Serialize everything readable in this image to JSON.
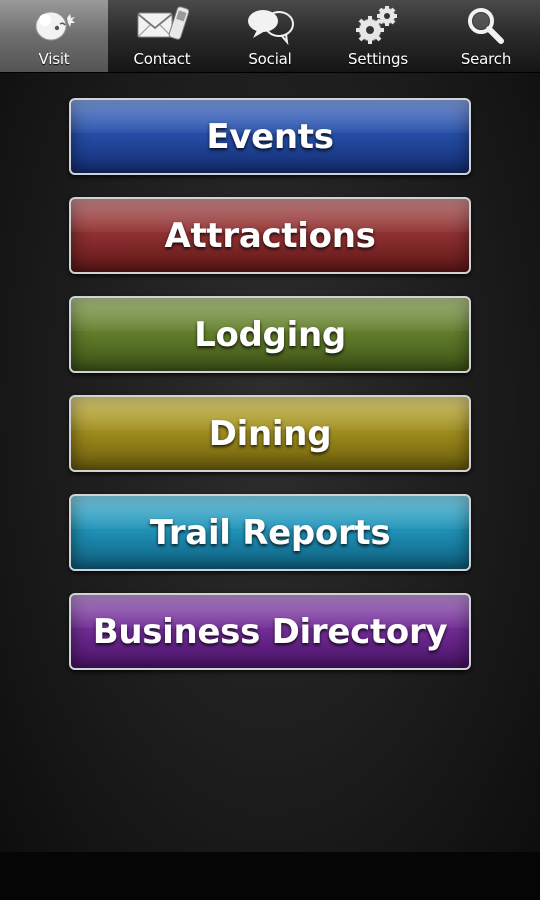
{
  "tabs": [
    {
      "label": "Visit",
      "icon": "face-icon",
      "selected": true
    },
    {
      "label": "Contact",
      "icon": "mail-phone-icon",
      "selected": false
    },
    {
      "label": "Social",
      "icon": "speech-bubbles-icon",
      "selected": false
    },
    {
      "label": "Settings",
      "icon": "gears-icon",
      "selected": false
    },
    {
      "label": "Search",
      "icon": "magnifier-icon",
      "selected": false
    }
  ],
  "menu": [
    {
      "label": "Events",
      "color": "#244ba3"
    },
    {
      "label": "Attractions",
      "color": "#8c2f30"
    },
    {
      "label": "Lodging",
      "color": "#607b2b"
    },
    {
      "label": "Dining",
      "color": "#9c8a1d"
    },
    {
      "label": "Trail Reports",
      "color": "#1e8eb3"
    },
    {
      "label": "Business Directory",
      "color": "#6e2b93"
    }
  ]
}
